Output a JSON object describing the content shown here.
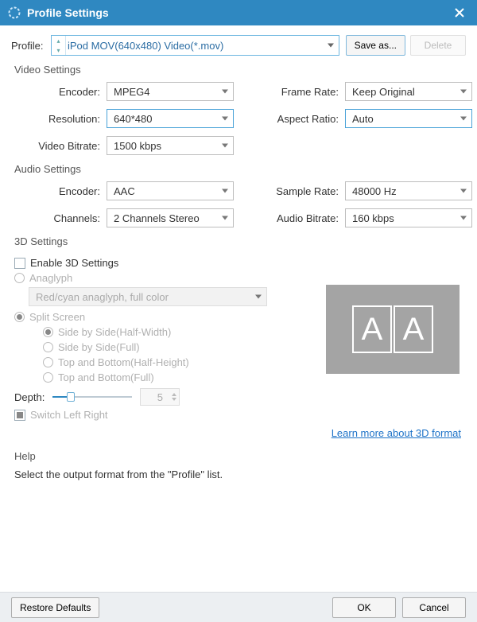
{
  "title": "Profile Settings",
  "profile_label": "Profile:",
  "profile_value": "iPod MOV(640x480) Video(*.mov)",
  "save_as": "Save as...",
  "delete": "Delete",
  "video": {
    "title": "Video Settings",
    "encoder_label": "Encoder:",
    "encoder": "MPEG4",
    "framerate_label": "Frame Rate:",
    "framerate": "Keep Original",
    "resolution_label": "Resolution:",
    "resolution": "640*480",
    "aspect_label": "Aspect Ratio:",
    "aspect": "Auto",
    "vbitrate_label": "Video Bitrate:",
    "vbitrate": "1500 kbps"
  },
  "audio": {
    "title": "Audio Settings",
    "encoder_label": "Encoder:",
    "encoder": "AAC",
    "samplerate_label": "Sample Rate:",
    "samplerate": "48000 Hz",
    "channels_label": "Channels:",
    "channels": "2 Channels Stereo",
    "abitrate_label": "Audio Bitrate:",
    "abitrate": "160 kbps"
  },
  "three_d": {
    "title": "3D Settings",
    "enable": "Enable 3D Settings",
    "anaglyph": "Anaglyph",
    "anaglyph_mode": "Red/cyan anaglyph, full color",
    "split": "Split Screen",
    "sbs_half": "Side by Side(Half-Width)",
    "sbs_full": "Side by Side(Full)",
    "tab_half": "Top and Bottom(Half-Height)",
    "tab_full": "Top and Bottom(Full)",
    "depth_label": "Depth:",
    "depth_value": "5",
    "switch_lr": "Switch Left Right",
    "learn_more": "Learn more about 3D format"
  },
  "help": {
    "title": "Help",
    "text": "Select the output format from the \"Profile\" list."
  },
  "footer": {
    "restore": "Restore Defaults",
    "ok": "OK",
    "cancel": "Cancel"
  },
  "preview_glyph": "A"
}
